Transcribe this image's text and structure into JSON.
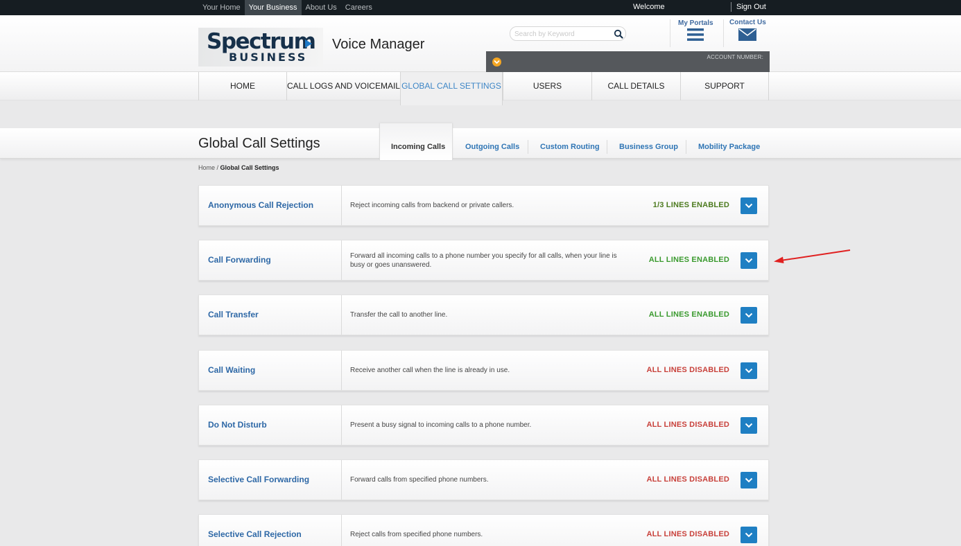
{
  "topnav": {
    "items": [
      "Your Home",
      "Your Business",
      "About Us",
      "Careers"
    ],
    "welcome": "Welcome",
    "sign_out": "Sign Out"
  },
  "header": {
    "logo_word": "Spectrum",
    "logo_sub": "BUSINESS",
    "app_title": "Voice Manager",
    "search_placeholder": "Search by Keyword",
    "my_portals": "My Portals",
    "contact_us": "Contact Us",
    "account_number_label": "ACCOUNT NUMBER:"
  },
  "mainnav": {
    "items": [
      "HOME",
      "CALL LOGS AND VOICEMAIL",
      "GLOBAL CALL SETTINGS",
      "USERS",
      "CALL DETAILS",
      "SUPPORT"
    ],
    "active": "GLOBAL CALL SETTINGS"
  },
  "page": {
    "title": "Global Call Settings",
    "subtabs": [
      "Incoming Calls",
      "Outgoing Calls",
      "Custom Routing",
      "Business Group",
      "Mobility Package"
    ],
    "active_subtab": "Incoming Calls",
    "breadcrumb": {
      "home": "Home",
      "separator": " / ",
      "current": "Global Call Settings"
    }
  },
  "settings": [
    {
      "name": "Anonymous Call Rejection",
      "description": "Reject incoming calls from backend or private callers.",
      "status": "1/3 LINES ENABLED",
      "state": "partial"
    },
    {
      "name": "Call Forwarding",
      "description": "Forward all incoming calls to a phone number you specify for all calls, when your line is busy or goes unanswered.",
      "status": "ALL LINES ENABLED",
      "state": "enabled"
    },
    {
      "name": "Call Transfer",
      "description": "Transfer the call to another line.",
      "status": "ALL LINES ENABLED",
      "state": "enabled"
    },
    {
      "name": "Call Waiting",
      "description": "Receive another call when the line is already in use.",
      "status": "ALL LINES DISABLED",
      "state": "disabled"
    },
    {
      "name": "Do Not Disturb",
      "description": "Present a busy signal to incoming calls to a phone number.",
      "status": "ALL LINES DISABLED",
      "state": "disabled"
    },
    {
      "name": "Selective Call Forwarding",
      "description": "Forward calls from specified phone numbers.",
      "status": "ALL LINES DISABLED",
      "state": "disabled"
    },
    {
      "name": "Selective Call Rejection",
      "description": "Reject calls from specified phone numbers.",
      "status": "ALL LINES DISABLED",
      "state": "disabled"
    }
  ],
  "colors": {
    "brand_navy": "#16304a",
    "accent_blue": "#1f7fc3",
    "enabled_green": "#3a9a2e",
    "partial_green": "#4c7a1e",
    "disabled_red": "#c8413b",
    "annotation_red": "#e02020"
  },
  "icons": {
    "search": "magnifier",
    "portals": "hamburger-menu",
    "contact": "envelope",
    "toggle": "chevron-down",
    "account_dropdown": "chevron-down-circle"
  }
}
